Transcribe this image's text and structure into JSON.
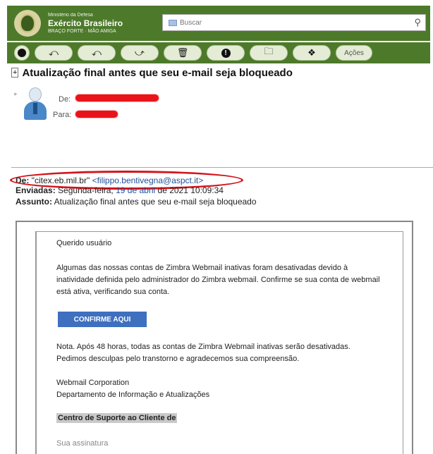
{
  "header": {
    "ministry": "Ministério da Defesa",
    "brand": "Exército Brasileiro",
    "motto": "BRAÇO FORTE · MÃO AMIGA",
    "search_placeholder": "Buscar"
  },
  "toolbar": {
    "buttons": [
      "close-icon",
      "reply-icon",
      "reply-all-icon",
      "forward-icon",
      "trash-icon",
      "alert-icon",
      "folder-icon",
      "tag-icon"
    ],
    "acoes_label": "Ações"
  },
  "message": {
    "subject": "Atualização final antes que seu e-mail seja bloqueado",
    "from_label": "De:",
    "to_label": "Para:",
    "redaction_color": "#e8141a"
  },
  "forwarded": {
    "from_label": "De:",
    "from_name": "\"citex.eb.mil.br\"",
    "from_email": "<filippo.bentivegna@aspct.it>",
    "sent_label": "Enviadas:",
    "sent_weekday": "Segunda-feira,",
    "sent_date": "19 de abril",
    "sent_rest": "de 2021 10:09:34",
    "subject_label": "Assunto:",
    "subject_value": "Atualização final antes que seu e-mail seja bloqueado"
  },
  "body": {
    "greeting": "Querido usuário",
    "paragraph1": "Algumas das nossas contas de Zimbra Webmail inativas foram desativadas devido à inatividade definida pelo administrador do Zimbra webmail. Confirme se sua conta de webmail está ativa, verificando sua conta.",
    "cta_label": "CONFIRME AQUI",
    "paragraph2": "Nota. Após 48 horas, todas as contas de Zimbra Webmail inativas serão desativadas. Pedimos desculpas pelo transtorno e agradecemos sua compreensão.",
    "sender_org": "Webmail Corporation",
    "sender_dept": "Departamento de Informação e Atualizações",
    "support_line": "Centro de Suporte ao Cliente de",
    "signature": "Sua assinatura"
  }
}
